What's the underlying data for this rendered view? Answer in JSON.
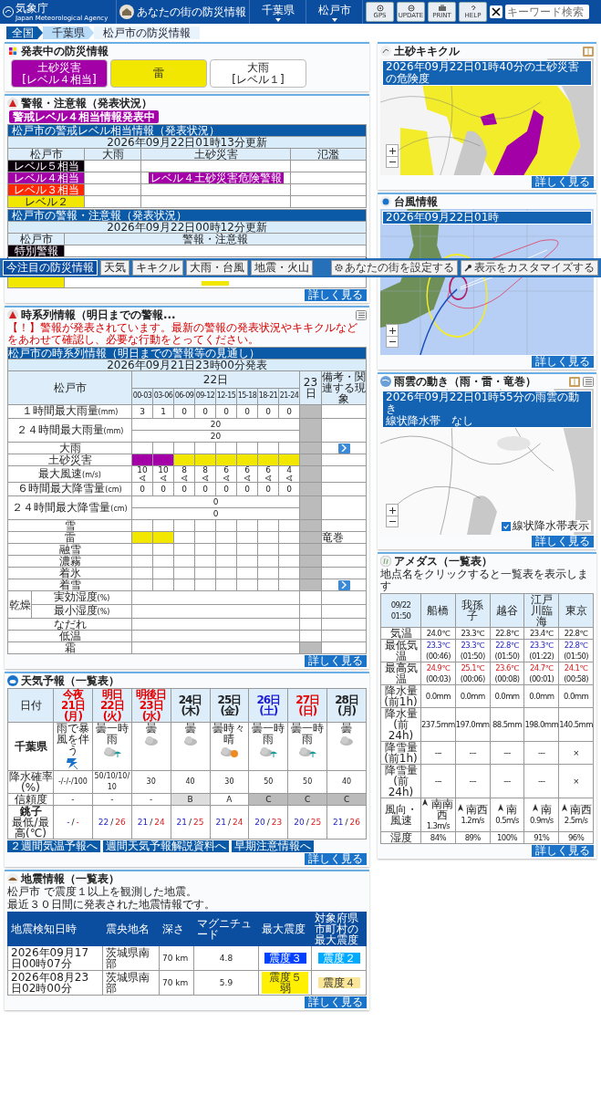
{
  "header": {
    "logo": "気象庁",
    "logo_sub": "Japan Meteorological Agency",
    "nav": [
      {
        "label": "あなたの街の防災情報",
        "kind": "home"
      },
      {
        "label": "千葉県",
        "kind": "dropdown"
      },
      {
        "label": "松戸市",
        "kind": "dropdown"
      }
    ],
    "tools": [
      "GPS",
      "UPDATE",
      "PRINT",
      "HELP"
    ],
    "search": {
      "placeholder": "キーワード検索"
    }
  },
  "breadcrumb": [
    "全国",
    "千葉県",
    "松戸市の防災情報"
  ],
  "toolbar": {
    "tabs": [
      {
        "label": "今注目の防災情報",
        "selected": true
      },
      {
        "label": "天気",
        "selected": false
      },
      {
        "label": "キキクル",
        "selected": false
      },
      {
        "label": "大雨・台風",
        "selected": false
      },
      {
        "label": "地震・火山",
        "selected": false
      }
    ],
    "actions": [
      "あなたの街を設定する",
      "表示をカスタマイズする"
    ]
  },
  "active_warnings": {
    "title": "発表中の防災情報",
    "items": [
      {
        "lines": [
          "土砂災害",
          "[レベル４相当]"
        ],
        "color": "#a400a8"
      },
      {
        "lines": [
          "雷"
        ],
        "color": "#f2e700"
      },
      {
        "lines": [
          "大雨",
          "[レベル１]"
        ],
        "color": "#ffffff"
      }
    ]
  },
  "warnings": {
    "title": "警報・注意報（発表状況）",
    "badge": "警戒レベル４相当情報発表中",
    "level_table": {
      "caption": "松戸市の警戒レベル相当情報（発表状況）",
      "updated": "2026年09月22日01時13分更新",
      "columns": [
        "松戸市",
        "大雨",
        "土砂災害",
        "氾濫"
      ],
      "rows": [
        {
          "label": "レベル５相当",
          "color": "#0c000c"
        },
        {
          "label": "レベル４相当",
          "color": "#a400a8",
          "landslide": "レベル４土砂災害危険警報"
        },
        {
          "label": "レベル３相当",
          "color": "#ff2800"
        },
        {
          "label": "レベル２",
          "color": "#f2e700"
        }
      ]
    },
    "warning_table": {
      "caption": "松戸市の警報・注意報（発表状況）",
      "updated": "2026年09月22日00時12分更新",
      "columns": [
        "松戸市",
        "警報・注意報"
      ],
      "rows": [
        {
          "label": "特別警報",
          "color": "#0c000c"
        },
        {
          "color": "#f2e700",
          "tag": {
            "color": "#f2e700"
          }
        }
      ]
    },
    "more": "詳しく見る"
  },
  "timeseries": {
    "title": "時系列情報（明日までの警報...",
    "notice": "【！】警報が発表されています。最新の警報の発表状況やキキクルなどをあわせて確認し、必要な行動をとってください。",
    "caption": "松戸市の時系列情報（明日までの警報等の見通し）",
    "issued": "2026年09月21日23時00分発表",
    "area": "松戸市",
    "day1": "22日",
    "day2": "23日",
    "remarks_header": "備考・関連する現象",
    "slots": [
      "00-03",
      "03-06",
      "06-09",
      "09-12",
      "12-15",
      "15-18",
      "18-21",
      "21-24"
    ],
    "rows": [
      {
        "kind": "values",
        "label": "１時間最大雨量",
        "unit": "(mm)",
        "values": [
          "3",
          "1",
          "0",
          "0",
          "0",
          "0",
          "0",
          "0"
        ],
        "day2_gray": true
      },
      {
        "kind": "span",
        "label": "２４時間最大雨量",
        "unit": "(mm)",
        "values": [
          "20",
          "20"
        ],
        "day2_gray": true
      },
      {
        "kind": "grid",
        "label": "大雨",
        "day2_gray": true,
        "next_button": true
      },
      {
        "kind": "colors",
        "label": "土砂災害",
        "cells": [
          {
            "filled": true,
            "color": "#a400a8"
          },
          {
            "filled": true,
            "color": "#a400a8"
          },
          {
            "filled": true,
            "color": "#f2e700"
          },
          {
            "filled": true,
            "color": "#f2e700"
          },
          {
            "filled": true,
            "color": "#f2e700"
          },
          {
            "filled": true,
            "color": "#f2e700"
          },
          {
            "filled": true,
            "color": "#f2e700"
          },
          {
            "filled": true,
            "color": "#f2e700"
          }
        ],
        "day2_gray": true
      },
      {
        "kind": "wind",
        "label": "最大風速",
        "unit": "(m/s)",
        "values": [
          "10",
          "10",
          "8",
          "8",
          "6",
          "6",
          "6",
          "4"
        ],
        "day2_gray": true
      },
      {
        "kind": "values",
        "label": "６時間最大降雪量",
        "unit": "(cm)",
        "values": [
          "0",
          "0",
          "0",
          "0",
          "0",
          "0",
          "0",
          "0"
        ],
        "day2_gray": true
      },
      {
        "kind": "span",
        "label": "２４時間最大降雪量",
        "unit": "(cm)",
        "values": [
          "0",
          "0"
        ],
        "day2_gray": true
      },
      {
        "kind": "grid",
        "label": "雪",
        "day2_gray": true
      },
      {
        "kind": "colors",
        "label": "雷",
        "cells": [
          {
            "filled": true,
            "color": "#f2e700"
          },
          {
            "filled": true,
            "color": "#f2e700"
          },
          {
            "filled": false
          },
          {
            "filled": false
          },
          {
            "filled": false
          },
          {
            "filled": false
          },
          {
            "filled": false
          },
          {
            "filled": false
          }
        ],
        "day2_gray": true,
        "remark": "竜巻"
      },
      {
        "kind": "grid",
        "label": "融雪",
        "day2_gray": true
      },
      {
        "kind": "grid",
        "label": "濃霧",
        "day2_gray": true
      },
      {
        "kind": "grid",
        "label": "着氷",
        "day2_gray": true
      },
      {
        "kind": "grid",
        "label": "着雪",
        "day2_gray": true,
        "next_button": true
      },
      {
        "kind": "group",
        "label": "乾燥",
        "children": [
          {
            "label": "実効湿度",
            "unit": "(%)",
            "day2_gray": false
          },
          {
            "label": "最小湿度",
            "unit": "(%)",
            "day2_gray": false
          }
        ]
      },
      {
        "kind": "empty",
        "label": "なだれ",
        "day2_gray": false
      },
      {
        "kind": "empty",
        "label": "低温",
        "day2_gray": false
      },
      {
        "kind": "empty",
        "label": "霜",
        "day2_gray": true
      }
    ],
    "more": "詳しく見る"
  },
  "forecast": {
    "title": "天気予報（一覧表）",
    "date_header": "日付",
    "region": "千葉県",
    "pop_label": "降水確率(%)",
    "reliability_label": "信頼度",
    "temp_station": "銚子",
    "temp_label": "最低/最高(℃)",
    "days": [
      {
        "lines": [
          "今夜",
          "21日(月)"
        ],
        "color": "#e60000",
        "weather": "雨で暴風を伴う",
        "kind": "storm",
        "pop": "-/-/-/100",
        "reliability": "-",
        "min": "-",
        "separator": "/",
        "max": "-"
      },
      {
        "lines": [
          "明日",
          "22日(火)"
        ],
        "color": "#e60000",
        "weather": "曇一時雨",
        "kind": "cloud_rain",
        "pop": "50/10/10/10",
        "reliability": "-",
        "min": "22",
        "separator": "/",
        "max": "26"
      },
      {
        "lines": [
          "明後日",
          "23日(水)"
        ],
        "color": "#e60000",
        "weather": "曇",
        "kind": "cloud",
        "pop": "30",
        "reliability": "-",
        "min": "21",
        "separator": "/",
        "max": "24"
      },
      {
        "lines": [
          "24日(木)"
        ],
        "color": "#222222",
        "weather": "曇",
        "kind": "cloud",
        "pop": "40",
        "reliability": "B",
        "min": "21",
        "separator": "/",
        "max": "25"
      },
      {
        "lines": [
          "25日(金)"
        ],
        "color": "#222222",
        "weather": "曇時々晴",
        "kind": "cloud_sun",
        "pop": "30",
        "reliability": "A",
        "min": "21",
        "separator": "/",
        "max": "24"
      },
      {
        "lines": [
          "26日(土)"
        ],
        "color": "#1a1ad0",
        "weather": "曇一時雨",
        "kind": "cloud_rain",
        "pop": "50",
        "reliability": "C",
        "min": "20",
        "separator": "/",
        "max": "23"
      },
      {
        "lines": [
          "27日(日)"
        ],
        "color": "#e60000",
        "weather": "曇一時雨",
        "kind": "cloud_rain",
        "pop": "50",
        "reliability": "C",
        "min": "20",
        "separator": "/",
        "max": "25"
      },
      {
        "lines": [
          "28日(月)"
        ],
        "color": "#222222",
        "weather": "曇",
        "kind": "cloud",
        "pop": "40",
        "reliability": "C",
        "min": "21",
        "separator": "/",
        "max": "26"
      }
    ],
    "links": [
      "２週間気温予報へ",
      "週間天気予報解説資料へ",
      "早期注意情報へ"
    ],
    "more": "詳しく見る"
  },
  "amedas": {
    "title": "アメダス（一覧表）",
    "note": "地点名をクリックすると一覧表を表示します",
    "time": "09/22 01:50",
    "stations": [
      "船橋",
      "我孫子",
      "越谷",
      "江戸川臨海",
      "東京"
    ],
    "rows": [
      {
        "kind": "plain",
        "label": [
          "気温"
        ],
        "values": [
          "24.0℃",
          "23.3℃",
          "22.8℃",
          "23.4℃",
          "22.8℃"
        ]
      },
      {
        "kind": "min",
        "label": [
          "最低気温"
        ],
        "values": [
          [
            "23.3℃",
            "(00:46)"
          ],
          [
            "23.3℃",
            "(01:50)"
          ],
          [
            "22.8℃",
            "(01:50)"
          ],
          [
            "23.3℃",
            "(01:22)"
          ],
          [
            "22.8℃",
            "(01:50)"
          ]
        ]
      },
      {
        "kind": "max",
        "label": [
          "最高気温"
        ],
        "values": [
          [
            "24.9℃",
            "(00:03)"
          ],
          [
            "25.1℃",
            "(00:06)"
          ],
          [
            "23.6℃",
            "(00:08)"
          ],
          [
            "24.7℃",
            "(00:01)"
          ],
          [
            "24.1℃",
            "(00:58)"
          ]
        ]
      },
      {
        "kind": "plain",
        "label": [
          "降水量",
          "(前1h)"
        ],
        "values": [
          "0.0mm",
          "0.0mm",
          "0.0mm",
          "0.0mm",
          "0.0mm"
        ]
      },
      {
        "kind": "plain",
        "label": [
          "降水量",
          "(前24h)"
        ],
        "values": [
          "237.5mm",
          "197.0mm",
          "88.5mm",
          "198.0mm",
          "140.5mm"
        ]
      },
      {
        "kind": "plain",
        "label": [
          "降雪量",
          "(前1h)"
        ],
        "values": [
          "---",
          "---",
          "---",
          "---",
          "×"
        ]
      },
      {
        "kind": "plain",
        "label": [
          "降雪量",
          "(前24h)"
        ],
        "values": [
          "---",
          "---",
          "---",
          "---",
          "×"
        ]
      },
      {
        "kind": "wind",
        "label": [
          "風向・",
          "風速"
        ],
        "values": [
          [
            "南南西",
            "1.3m/s"
          ],
          [
            "南西",
            "1.2m/s"
          ],
          [
            "南",
            "0.5m/s"
          ],
          [
            "南",
            "0.9m/s"
          ],
          [
            "南西",
            "2.5m/s"
          ]
        ]
      },
      {
        "kind": "plain",
        "label": [
          "湿度"
        ],
        "values": [
          "84%",
          "89%",
          "100%",
          "91%",
          "96%"
        ]
      }
    ],
    "more": "詳しく見る"
  },
  "earthquake": {
    "title": "地震情報（一覧表）",
    "note": [
      "松戸市 で震度１以上を観測した地震。",
      "最近３０日間に発表された地震情報です。"
    ],
    "columns": [
      [
        "地震検知日時"
      ],
      [
        "震央地名"
      ],
      [
        "深さ"
      ],
      [
        "マグニチュード"
      ],
      [
        "最大震度"
      ],
      [
        "対象府県",
        "市町村の",
        "最大震度"
      ]
    ],
    "rows": [
      {
        "time": "2026年09月17日00時07分",
        "place": "茨城県南部",
        "depth": "70 km",
        "magnitude": "4.8",
        "max": {
          "text": "震度３",
          "color": "#0041ff"
        },
        "local": {
          "text": "震度２",
          "color": "#00aaff"
        }
      },
      {
        "time": "2026年08月23日02時00分",
        "place": "茨城県南部",
        "depth": "70 km",
        "magnitude": "5.9",
        "max": {
          "text": "震度５弱",
          "color": "#fff000"
        },
        "local": {
          "text": "震度４",
          "color": "#fae696"
        }
      }
    ],
    "more": "詳しく見る"
  },
  "maps": [
    {
      "kind": "kikikuru",
      "title": "土砂キキクル",
      "caption": [
        "2026年09月22日01時40分の土砂災害の危険度"
      ],
      "more": "詳しく見る"
    },
    {
      "kind": "typhoon",
      "title": "台風情報",
      "caption": [
        "2026年09月22日01時"
      ],
      "more": "詳しく見る"
    },
    {
      "kind": "rain",
      "title": "雨雲の動き（雨・雷・竜巻）",
      "caption": [
        "2026年09月22日01時55分の雨雲の動き",
        "線状降水帯　なし"
      ],
      "checkbox": {
        "label": "線状降水帯表示",
        "checked": true
      },
      "more": "詳しく見る"
    }
  ]
}
